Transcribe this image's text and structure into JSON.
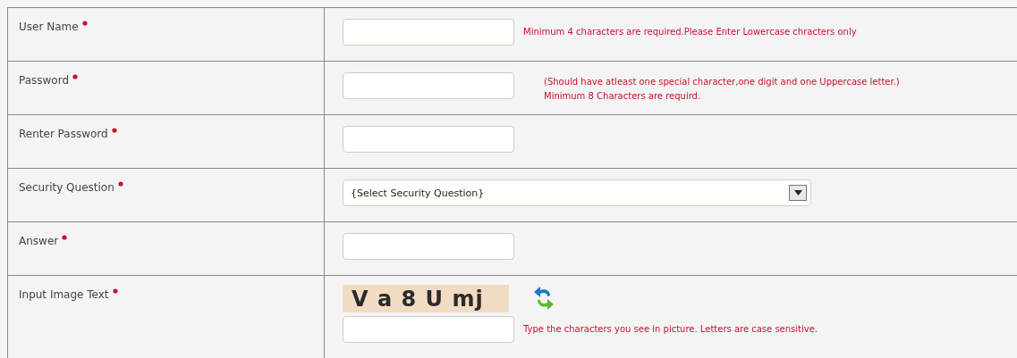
{
  "rows": [
    {
      "label": "User Name",
      "required": true,
      "kind": "text",
      "hint": "Minimum 4 characters are required.Please Enter Lowercase chracters only"
    },
    {
      "label": "Password",
      "required": true,
      "kind": "text",
      "hint_lines": [
        "(Should have atleast one special character,one digit and one Uppercase letter.)",
        "Minimum 8 Characters are requird."
      ]
    },
    {
      "label": "Renter Password",
      "required": true,
      "kind": "text"
    },
    {
      "label": "Security Question",
      "required": true,
      "kind": "select",
      "value": "{Select Security Question}"
    },
    {
      "label": "Answer",
      "required": true,
      "kind": "text"
    },
    {
      "label": "Input Image Text",
      "required": true,
      "kind": "captcha",
      "captcha": "V a 8 U mj",
      "hint": "Type the characters you see in picture. Letters are case sensitive."
    }
  ]
}
